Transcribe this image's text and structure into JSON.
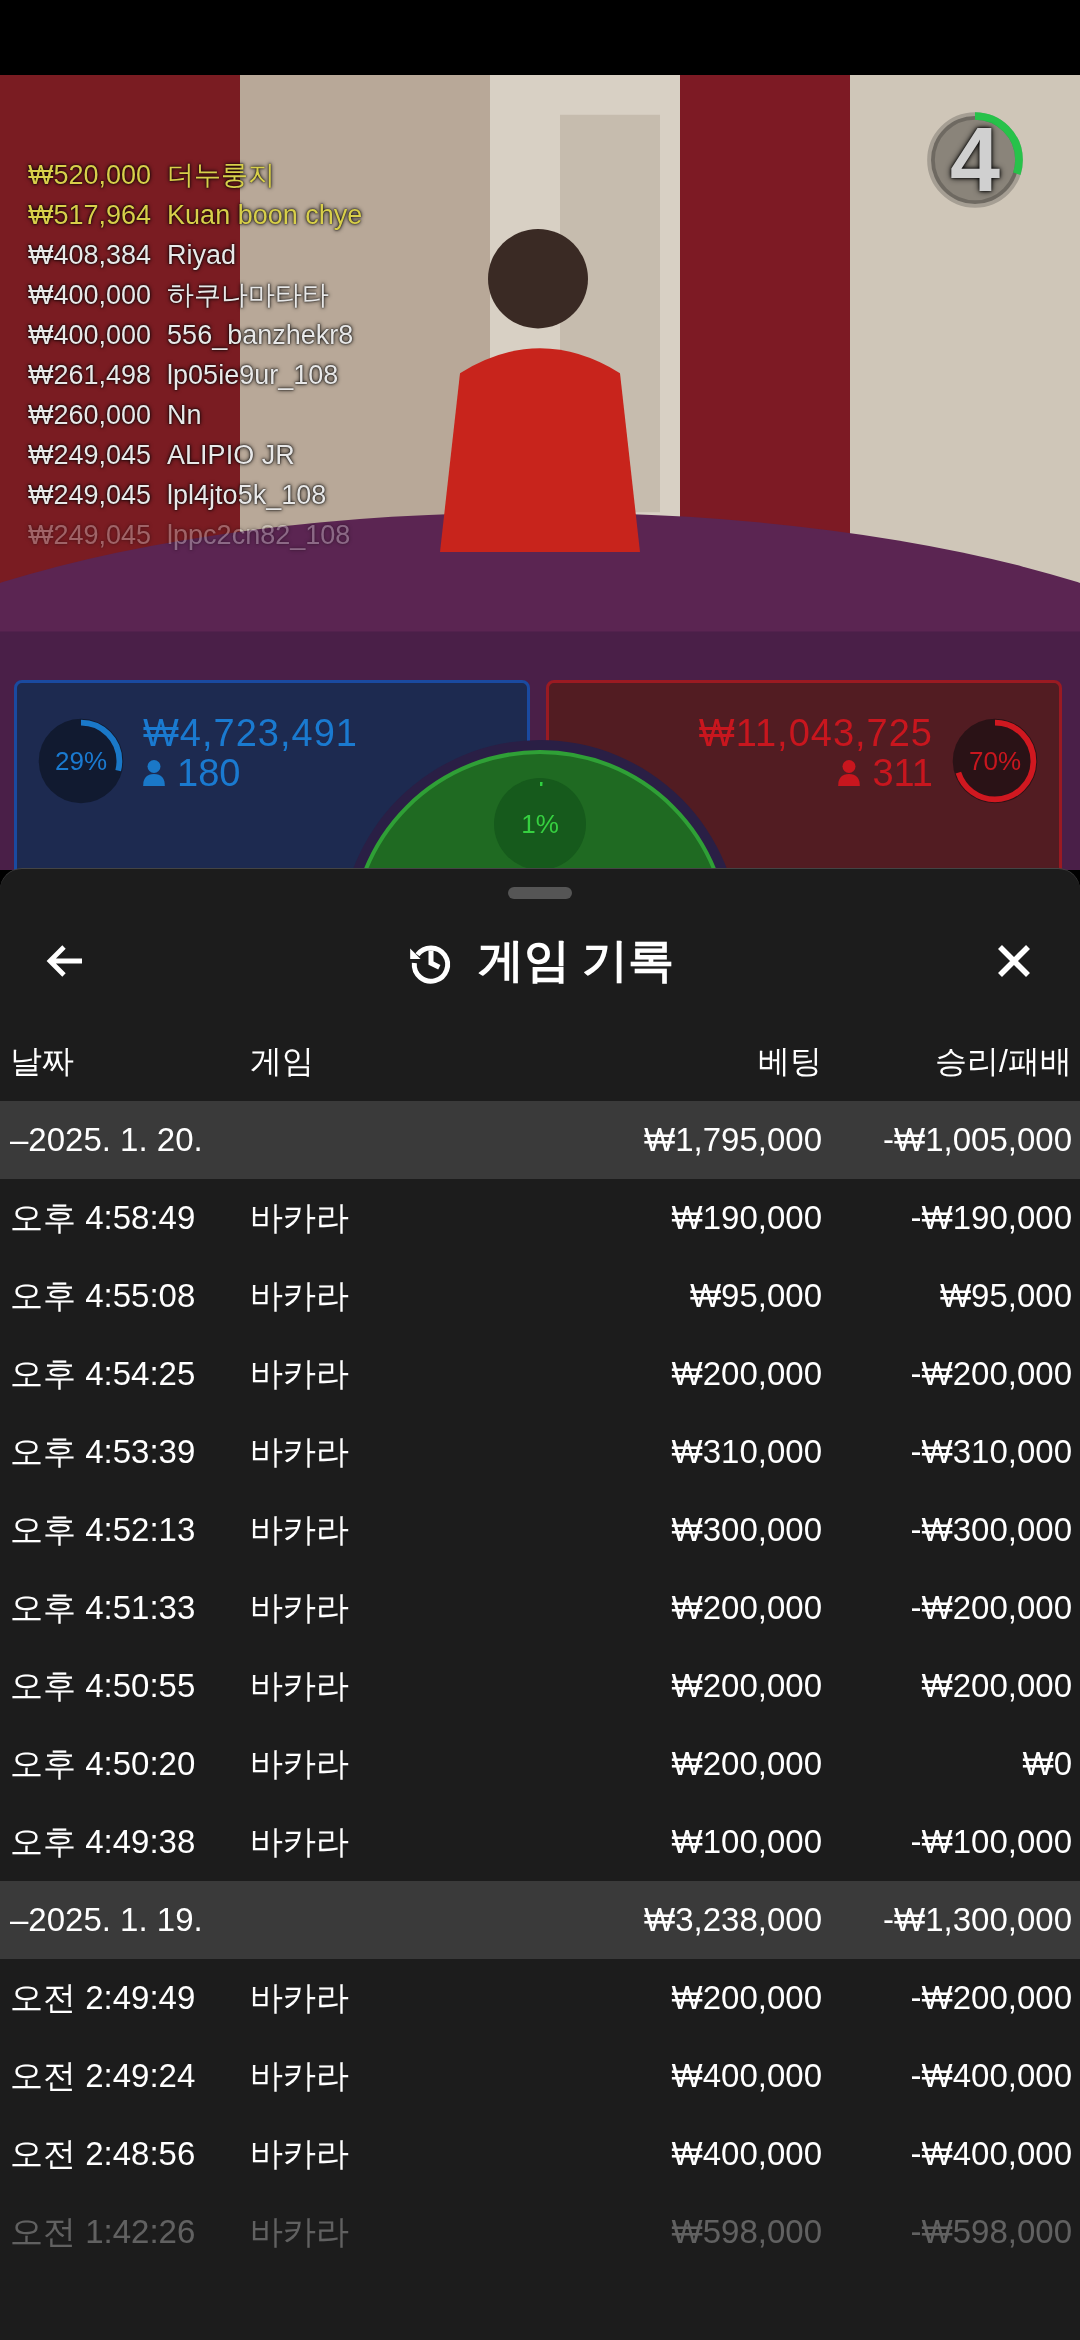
{
  "countdown": {
    "value": "4",
    "level": 0.3
  },
  "leaderboard": [
    {
      "amount": "₩520,000",
      "name": "더누룽지",
      "highlight": true
    },
    {
      "amount": "₩517,964",
      "name": "Kuan boon chye",
      "highlight": true
    },
    {
      "amount": "₩408,384",
      "name": "Riyad",
      "highlight": false
    },
    {
      "amount": "₩400,000",
      "name": "하쿠나마타타",
      "highlight": false
    },
    {
      "amount": "₩400,000",
      "name": "556_banzhekr8",
      "highlight": false
    },
    {
      "amount": "₩261,498",
      "name": "lp05ie9ur_108",
      "highlight": false
    },
    {
      "amount": "₩260,000",
      "name": "Nn",
      "highlight": false
    },
    {
      "amount": "₩249,045",
      "name": "ALIPIO JR",
      "highlight": false
    },
    {
      "amount": "₩249,045",
      "name": "lpl4jto5k_108",
      "highlight": false
    },
    {
      "amount": "₩249,045",
      "name": "lppc2cn82_108",
      "highlight": false
    }
  ],
  "bets": {
    "player": {
      "percent": "29%",
      "level": 0.29,
      "amount": "₩4,723,491",
      "players": "180"
    },
    "banker": {
      "percent": "70%",
      "level": 0.7,
      "amount": "₩11,043,725",
      "players": "311"
    },
    "tie": {
      "percent": "1%",
      "level": 0.01
    }
  },
  "sheet": {
    "title": "게임 기록",
    "columns": [
      "날짜",
      "게임",
      "베팅",
      "승리/패배"
    ],
    "groups": [
      {
        "date": "–2025. 1. 20.",
        "bet": "₩1,795,000",
        "result": "-₩1,005,000",
        "rows": [
          {
            "time": "오후 4:58:49",
            "game": "바카라",
            "bet": "₩190,000",
            "result": "-₩190,000"
          },
          {
            "time": "오후 4:55:08",
            "game": "바카라",
            "bet": "₩95,000",
            "result": "₩95,000"
          },
          {
            "time": "오후 4:54:25",
            "game": "바카라",
            "bet": "₩200,000",
            "result": "-₩200,000"
          },
          {
            "time": "오후 4:53:39",
            "game": "바카라",
            "bet": "₩310,000",
            "result": "-₩310,000"
          },
          {
            "time": "오후 4:52:13",
            "game": "바카라",
            "bet": "₩300,000",
            "result": "-₩300,000"
          },
          {
            "time": "오후 4:51:33",
            "game": "바카라",
            "bet": "₩200,000",
            "result": "-₩200,000"
          },
          {
            "time": "오후 4:50:55",
            "game": "바카라",
            "bet": "₩200,000",
            "result": "₩200,000"
          },
          {
            "time": "오후 4:50:20",
            "game": "바카라",
            "bet": "₩200,000",
            "result": "₩0"
          },
          {
            "time": "오후 4:49:38",
            "game": "바카라",
            "bet": "₩100,000",
            "result": "-₩100,000"
          }
        ]
      },
      {
        "date": "–2025. 1. 19.",
        "bet": "₩3,238,000",
        "result": "-₩1,300,000",
        "rows": [
          {
            "time": "오전 2:49:49",
            "game": "바카라",
            "bet": "₩200,000",
            "result": "-₩200,000"
          },
          {
            "time": "오전 2:49:24",
            "game": "바카라",
            "bet": "₩400,000",
            "result": "-₩400,000"
          },
          {
            "time": "오전 2:48:56",
            "game": "바카라",
            "bet": "₩400,000",
            "result": "-₩400,000"
          },
          {
            "time": "오전 1:42:26",
            "game": "바카라",
            "bet": "₩598,000",
            "result": "-₩598,000"
          }
        ]
      }
    ]
  }
}
